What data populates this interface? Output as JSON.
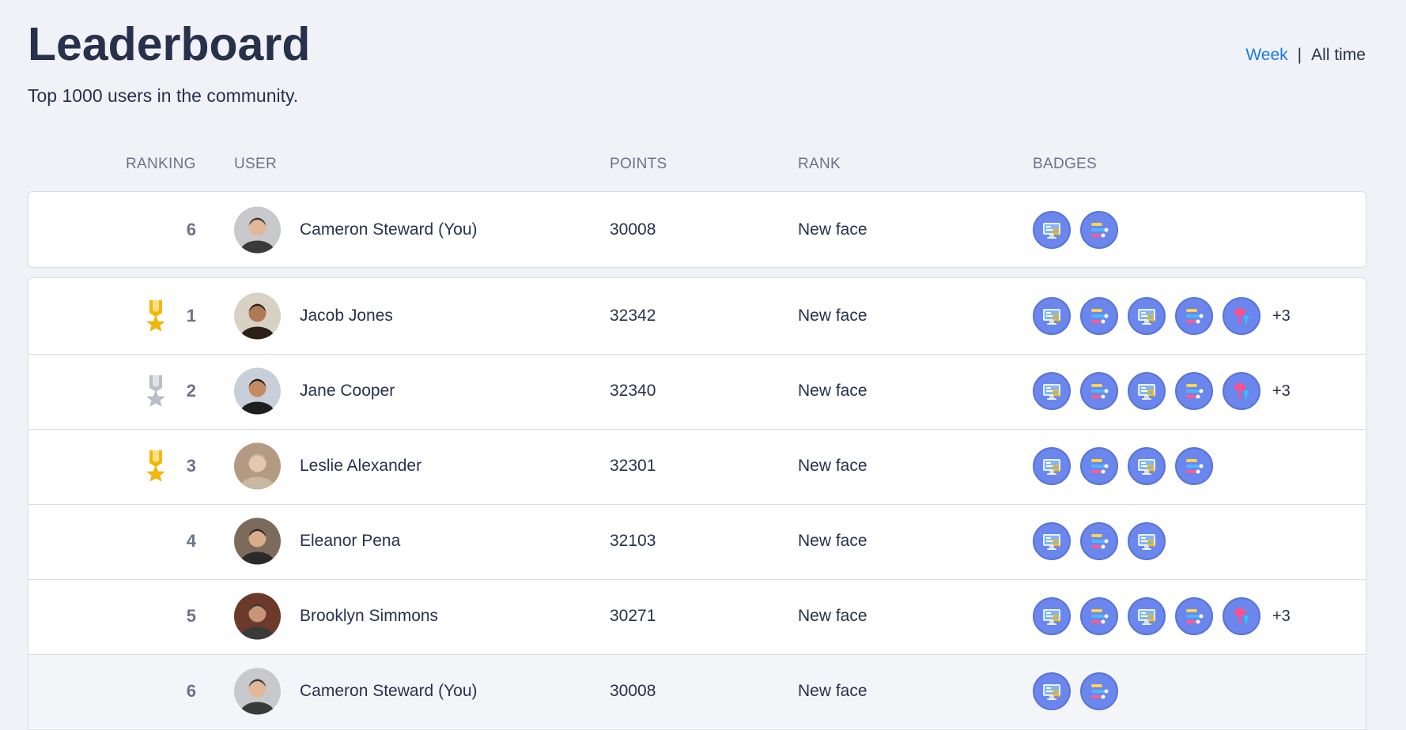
{
  "header": {
    "title": "Leaderboard",
    "subtitle": "Top 1000 users in the community."
  },
  "filter": {
    "week_label": "Week",
    "separator": "|",
    "alltime_label": "All time"
  },
  "columns": {
    "ranking": "RANKING",
    "user": "USER",
    "points": "POINTS",
    "rank": "RANK",
    "badges": "BADGES"
  },
  "current_user": {
    "ranking": "6",
    "name": "Cameron Steward (You)",
    "points": "30008",
    "rank": "New face",
    "badges": [
      "monitor-chart-icon",
      "toggle-list-icon"
    ]
  },
  "rows": [
    {
      "ranking": "1",
      "medal": "gold",
      "name": "Jacob Jones",
      "points": "32342",
      "rank": "New face",
      "badges": [
        "monitor-chart-icon",
        "toggle-list-icon",
        "monitor-chart-icon",
        "toggle-list-icon",
        "pushpin-icon"
      ],
      "more": "+3"
    },
    {
      "ranking": "2",
      "medal": "silver",
      "name": "Jane Cooper",
      "points": "32340",
      "rank": "New face",
      "badges": [
        "monitor-chart-icon",
        "toggle-list-icon",
        "monitor-chart-icon",
        "toggle-list-icon",
        "pushpin-icon"
      ],
      "more": "+3"
    },
    {
      "ranking": "3",
      "medal": "bronze",
      "name": "Leslie Alexander",
      "points": "32301",
      "rank": "New face",
      "badges": [
        "monitor-chart-icon",
        "toggle-list-icon",
        "monitor-chart-icon",
        "toggle-list-icon"
      ],
      "more": ""
    },
    {
      "ranking": "4",
      "medal": "",
      "name": "Eleanor Pena",
      "points": "32103",
      "rank": "New face",
      "badges": [
        "monitor-chart-icon",
        "toggle-list-icon",
        "monitor-chart-icon"
      ],
      "more": ""
    },
    {
      "ranking": "5",
      "medal": "",
      "name": "Brooklyn Simmons",
      "points": "30271",
      "rank": "New face",
      "badges": [
        "monitor-chart-icon",
        "toggle-list-icon",
        "monitor-chart-icon",
        "toggle-list-icon",
        "pushpin-icon"
      ],
      "more": "+3"
    },
    {
      "ranking": "6",
      "medal": "",
      "name": "Cameron Steward (You)",
      "points": "30008",
      "rank": "New face",
      "badges": [
        "monitor-chart-icon",
        "toggle-list-icon"
      ],
      "more": ""
    }
  ],
  "colors": {
    "accent": "#1a7ae3",
    "badge_bg": "#6b86ec",
    "gold": "#f5b800",
    "silver": "#b9bec8"
  }
}
